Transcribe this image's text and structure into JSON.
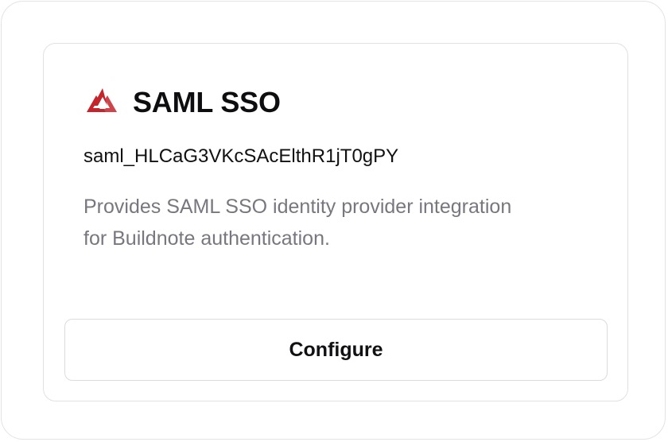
{
  "card": {
    "title": "SAML SSO",
    "identifier": "saml_HLCaG3VKcSAcElthR1jT0gPY",
    "description": "Provides SAML SSO identity provider integration for Buildnote authentication.",
    "button_label": "Configure",
    "logo_icon": "saml-logo-icon",
    "logo_color": "#c4242b"
  }
}
